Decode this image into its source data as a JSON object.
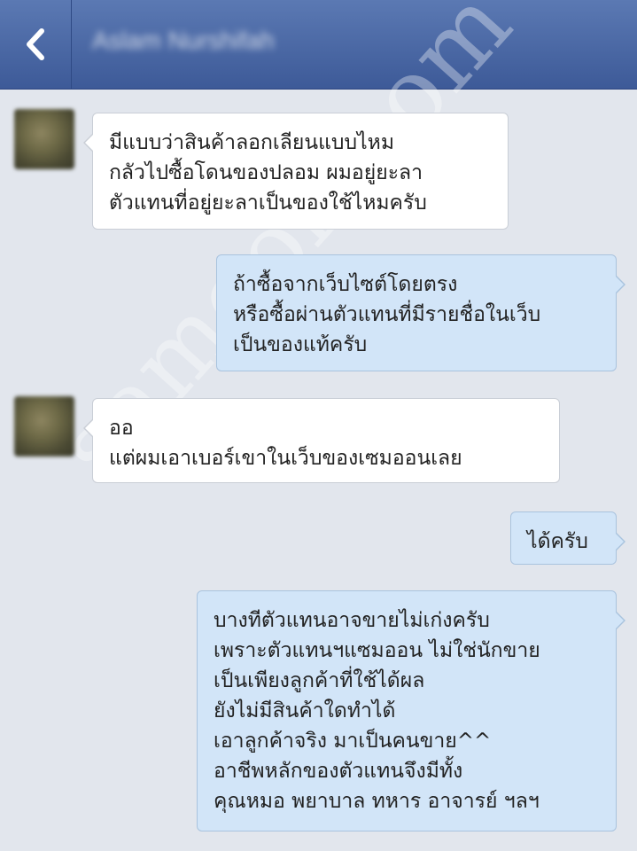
{
  "header": {
    "contact_name": "Aslam Nurshifah",
    "back_icon": "chevron-left-icon",
    "bar_color": "#4a67a6"
  },
  "messages": [
    {
      "direction": "incoming",
      "text": "มีแบบว่าสินค้าลอกเลียนแบบไหม\nกลัวไปซื้อโดนของปลอม ผมอยู่ยะลา\nตัวแทนที่อยู่ยะลาเป็นของใช้ไหมครับ"
    },
    {
      "direction": "outgoing",
      "text": "ถ้าซื้อจากเว็บไซต์โดยตรง\nหรือซื้อผ่านตัวแทนที่มีรายชื่อในเว็บ\nเป็นของแท้ครับ"
    },
    {
      "direction": "incoming",
      "text": "ออ\nแต่ผมเอาเบอร์เขาในเว็บของเซมออนเลย"
    },
    {
      "direction": "outgoing",
      "text": "ได้ครับ"
    },
    {
      "direction": "outgoing",
      "text": "บางทีตัวแทนอาจขายไม่เก่งครับ\nเพราะตัวแทนฯแซมออน ไม่ใช่นักขาย\nเป็นเพียงลูกค้าที่ใช้ได้ผล\nยังไม่มีสินค้าใดทำได้\nเอาลูกค้าจริง มาเป็นคนขาย^^\nอาชีพหลักของตัวแทนจึงมีทั้ง\nคุณหมอ พยาบาล ทหาร อาจารย์ ฯลฯ"
    }
  ],
  "watermark": "samoon.com",
  "colors": {
    "chat_background": "#e2e6ed",
    "incoming_bubble": "#ffffff",
    "outgoing_bubble": "#d2e5f8"
  }
}
